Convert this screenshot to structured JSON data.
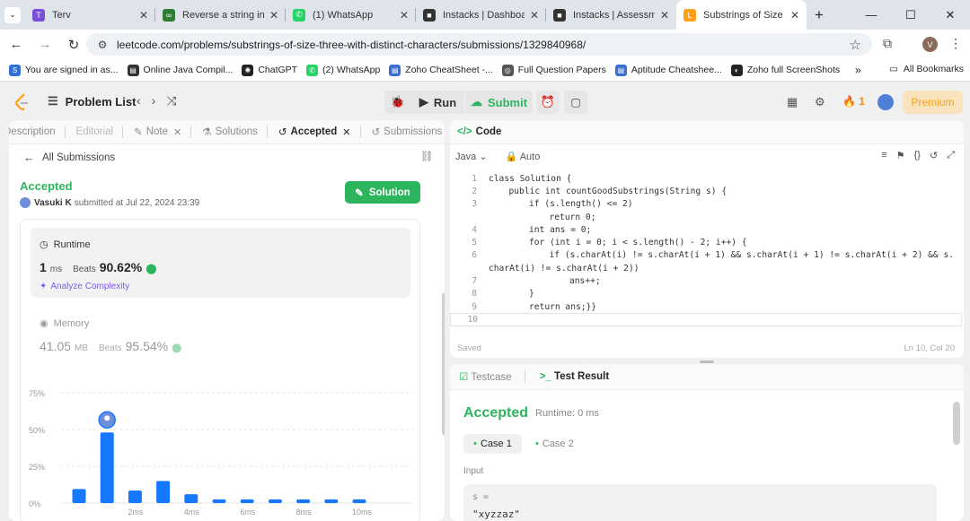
{
  "browser": {
    "tabs": [
      {
        "title": "Terv",
        "color": "#7b4fd6",
        "glyph": "T"
      },
      {
        "title": "Reverse a string in Ja",
        "color": "#2e7d32",
        "glyph": "∞"
      },
      {
        "title": "(1) WhatsApp",
        "color": "#25d366",
        "glyph": "✆"
      },
      {
        "title": "Instacks | Dashboard",
        "color": "#333333",
        "glyph": "■"
      },
      {
        "title": "Instacks | Assessment",
        "color": "#333333",
        "glyph": "■"
      },
      {
        "title": "Substrings of Size Th",
        "color": "#ffa116",
        "glyph": "L"
      }
    ],
    "url": "leetcode.com/problems/substrings-of-size-three-with-distinct-characters/submissions/1329840968/",
    "profile_initial": "V",
    "bookmarks": [
      {
        "label": "You are signed in as...",
        "color": "#2f6fd6",
        "glyph": "S"
      },
      {
        "label": "Online Java Compil...",
        "color": "#333333",
        "glyph": "▤"
      },
      {
        "label": "ChatGPT",
        "color": "#222222",
        "glyph": "✺"
      },
      {
        "label": "(2) WhatsApp",
        "color": "#25d366",
        "glyph": "✆"
      },
      {
        "label": "Zoho CheatSheet -...",
        "color": "#3b6fd4",
        "glyph": "▤"
      },
      {
        "label": "Full Question Papers",
        "color": "#555555",
        "glyph": "◎"
      },
      {
        "label": "Aptitude Cheatshee...",
        "color": "#3b6fd4",
        "glyph": "▤"
      },
      {
        "label": "Zoho full ScreenShots",
        "color": "#222222",
        "glyph": "◐"
      }
    ],
    "all_bookmarks": "All Bookmarks"
  },
  "header": {
    "problem_list": "Problem List",
    "run": "Run",
    "submit": "Submit",
    "streak": "1",
    "premium": "Premium"
  },
  "left_tabs": {
    "description": "Description",
    "editorial": "Editorial",
    "note": "Note",
    "solutions": "Solutions",
    "accepted": "Accepted",
    "submissions": "Submissions"
  },
  "submission": {
    "all_submissions": "All Submissions",
    "status": "Accepted",
    "user": "Vasuki K",
    "submitted_at": "submitted at Jul 22, 2024 23:39",
    "solution_button": "Solution",
    "runtime_label": "Runtime",
    "runtime_value": "1",
    "runtime_unit": "ms",
    "beats_label": "Beats",
    "runtime_beats": "90.62%",
    "analyze": "Analyze Complexity",
    "memory_label": "Memory",
    "memory_value": "41.05",
    "memory_unit": "MB",
    "memory_beats": "95.54%"
  },
  "chart_data": {
    "type": "bar",
    "y_ticks": [
      "75%",
      "50%",
      "25%",
      "0%"
    ],
    "ylim": [
      0,
      75
    ],
    "x_ticks": [
      "2ms",
      "4ms",
      "6ms",
      "8ms",
      "10ms"
    ],
    "categories": [
      "0ms",
      "1ms",
      "2ms",
      "3ms",
      "4ms",
      "5ms",
      "6ms",
      "7ms",
      "8ms",
      "9ms",
      "10ms"
    ],
    "values": [
      9.5,
      48,
      8.5,
      15,
      6,
      2.5,
      2.5,
      2.5,
      2.5,
      2.5,
      2.5
    ],
    "highlight_index": 1,
    "bar_color": "#1677ff"
  },
  "code_panel": {
    "title": "Code",
    "language": "Java",
    "mode": "Auto",
    "lines": [
      {
        "n": "1",
        "indent": 0,
        "text": "class Solution {"
      },
      {
        "n": "2",
        "indent": 1,
        "text": "public int countGoodSubstrings(String s) {"
      },
      {
        "n": "3",
        "indent": 2,
        "text": "if (s.length() <= 2)"
      },
      {
        "n": "",
        "indent": 3,
        "text": "return 0;"
      },
      {
        "n": "4",
        "indent": 2,
        "text": "int ans = 0;"
      },
      {
        "n": "5",
        "indent": 2,
        "text": "for (int i = 0; i < s.length() - 2; i++) {"
      },
      {
        "n": "6",
        "indent": 3,
        "text": "if (s.charAt(i) != s.charAt(i + 1) && s.charAt(i + 1) != s.charAt(i + 2) && s."
      },
      {
        "n": "",
        "indent": 0,
        "text": "charAt(i) != s.charAt(i + 2))"
      },
      {
        "n": "7",
        "indent": 4,
        "text": "ans++;"
      },
      {
        "n": "8",
        "indent": 2,
        "text": "}"
      },
      {
        "n": "9",
        "indent": 2,
        "text": "return ans;}}"
      },
      {
        "n": "10",
        "indent": 0,
        "text": ""
      }
    ],
    "saved": "Saved",
    "cursor": "Ln 10, Col 20"
  },
  "test_panel": {
    "testcase_tab": "Testcase",
    "result_tab": "Test Result",
    "status": "Accepted",
    "runtime": "Runtime: 0 ms",
    "case1": "Case 1",
    "case2": "Case 2",
    "input_label": "Input",
    "var_name": "s =",
    "var_value": "\"xyzzaz\""
  }
}
